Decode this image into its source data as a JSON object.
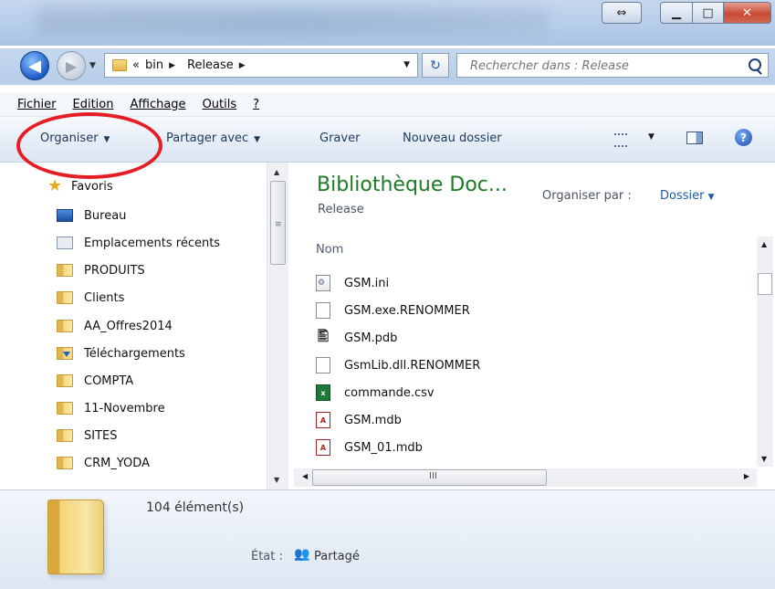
{
  "address": {
    "overflow": "«",
    "crumbs": [
      "bin",
      "Release"
    ]
  },
  "search": {
    "placeholder": "Rechercher dans : Release"
  },
  "menu": {
    "items": [
      "Fichier",
      "Edition",
      "Affichage",
      "Outils",
      "?"
    ]
  },
  "toolbar": {
    "organize": "Organiser",
    "share": "Partager avec",
    "burn": "Graver",
    "new_folder": "Nouveau dossier"
  },
  "nav": {
    "favorites": "Favoris",
    "items": [
      {
        "label": "Bureau",
        "icon": "desktop-icon"
      },
      {
        "label": "Emplacements récents",
        "icon": "recent-places-icon"
      },
      {
        "label": "PRODUITS",
        "icon": "folder-icon"
      },
      {
        "label": "Clients",
        "icon": "folder-icon"
      },
      {
        "label": "AA_Offres2014",
        "icon": "folder-icon"
      },
      {
        "label": "Téléchargements",
        "icon": "downloads-icon"
      },
      {
        "label": "COMPTA",
        "icon": "folder-icon"
      },
      {
        "label": "11-Novembre",
        "icon": "folder-icon"
      },
      {
        "label": "SITES",
        "icon": "folder-icon"
      },
      {
        "label": "CRM_YODA",
        "icon": "folder-icon"
      }
    ]
  },
  "library": {
    "title": "Bibliothèque Doc...",
    "subtitle": "Release",
    "arrange_label": "Organiser par :",
    "arrange_value": "Dossier"
  },
  "files": {
    "column_name": "Nom",
    "items": [
      {
        "name": "GSM.ini",
        "type": "ini"
      },
      {
        "name": "GSM.exe.RENOMMER",
        "type": "blank"
      },
      {
        "name": "GSM.pdb",
        "type": "pdb"
      },
      {
        "name": "GsmLib.dll.RENOMMER",
        "type": "blank"
      },
      {
        "name": "commande.csv",
        "type": "csv"
      },
      {
        "name": "GSM.mdb",
        "type": "mdb"
      },
      {
        "name": "GSM_01.mdb",
        "type": "mdb"
      }
    ]
  },
  "details": {
    "count": "104 élément(s)",
    "state_label": "État :",
    "state_value": "Partagé"
  },
  "colors": {
    "library_title": "#1d7b25",
    "annotation_circle": "#e51e25",
    "link_blue": "#1e5aa8"
  }
}
